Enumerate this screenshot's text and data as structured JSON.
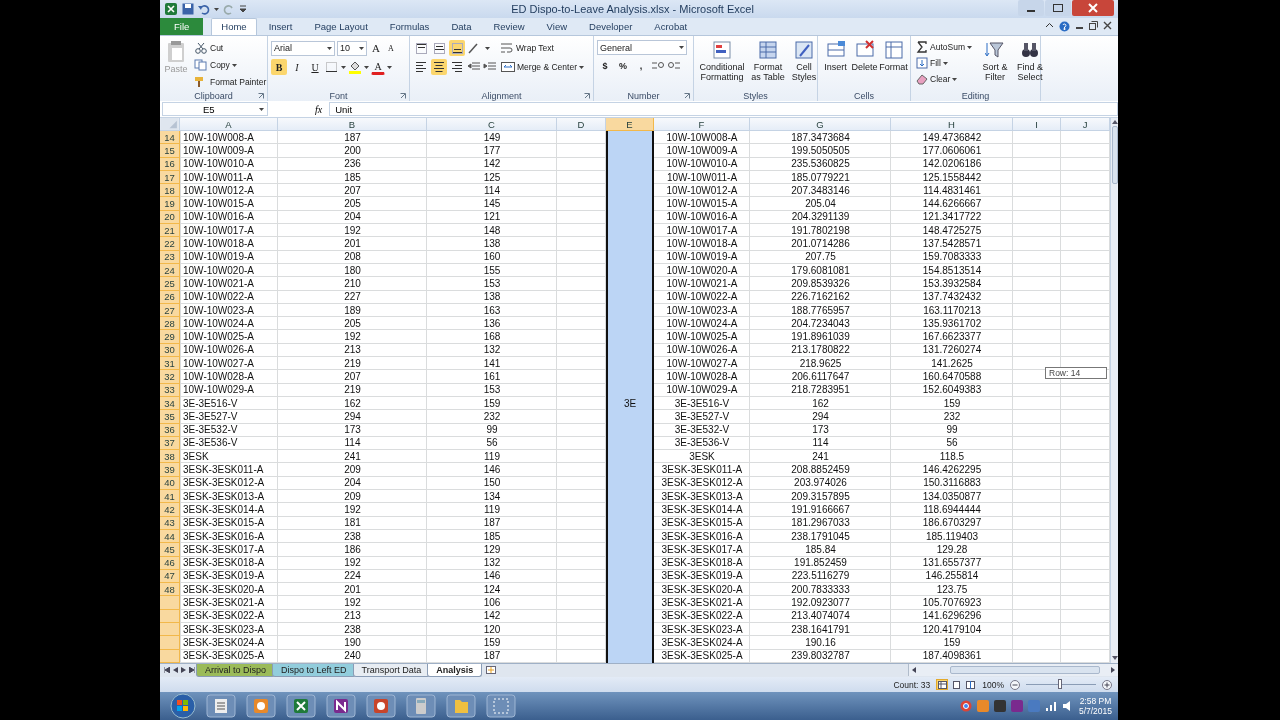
{
  "window": {
    "title": "ED Dispo-to-Leave Analysis.xlsx - Microsoft Excel"
  },
  "ribbon": {
    "tabs": [
      {
        "label": "File",
        "kind": "file",
        "selected": false
      },
      {
        "label": "Home",
        "kind": "tab",
        "selected": true
      },
      {
        "label": "Insert",
        "kind": "tab",
        "selected": false
      },
      {
        "label": "Page Layout",
        "kind": "tab",
        "selected": false
      },
      {
        "label": "Formulas",
        "kind": "tab",
        "selected": false
      },
      {
        "label": "Data",
        "kind": "tab",
        "selected": false
      },
      {
        "label": "Review",
        "kind": "tab",
        "selected": false
      },
      {
        "label": "View",
        "kind": "tab",
        "selected": false
      },
      {
        "label": "Developer",
        "kind": "tab",
        "selected": false
      },
      {
        "label": "Acrobat",
        "kind": "tab",
        "selected": false
      }
    ],
    "clipboard": {
      "label": "Clipboard",
      "paste": {
        "label": "Paste",
        "disabled": true
      },
      "cut": "Cut",
      "copy": "Copy",
      "format_painter": "Format Painter"
    },
    "font": {
      "label": "Font",
      "name": "Arial",
      "size": "10",
      "grow": "A",
      "shrink": "A",
      "font_color": "A",
      "styles": [
        {
          "text": "B",
          "kind": "bold",
          "on": true
        },
        {
          "text": "I",
          "kind": "italic",
          "on": false
        },
        {
          "text": "U",
          "kind": "underline",
          "on": false
        }
      ]
    },
    "alignment": {
      "label": "Alignment",
      "wrap_text": "Wrap Text",
      "merge": "Merge & Center",
      "vertical": [
        {
          "selected": false
        },
        {
          "selected": false
        },
        {
          "selected": true
        }
      ],
      "horizontal": [
        {
          "selected": false
        },
        {
          "selected": true
        },
        {
          "selected": false
        }
      ]
    },
    "number": {
      "label": "Number",
      "format": "General",
      "symbols": [
        "$",
        "%",
        ","
      ]
    },
    "styles": {
      "label": "Styles",
      "buttons": [
        "Conditional Formatting",
        "Format as Table",
        "Cell Styles"
      ]
    },
    "cells": {
      "label": "Cells",
      "buttons": [
        "Insert",
        "Delete",
        "Format"
      ]
    },
    "editing": {
      "label": "Editing",
      "autosum": "AutoSum",
      "fill": "Fill",
      "clear": "Clear",
      "buttons": [
        "Sort & Filter",
        "Find & Select"
      ]
    }
  },
  "formula_bar": {
    "name_box": "E5",
    "function_button": "fx",
    "formula": "Unit"
  },
  "sheet": {
    "columns": [
      {
        "label": "A",
        "selected": false
      },
      {
        "label": "B",
        "selected": false
      },
      {
        "label": "C",
        "selected": false
      },
      {
        "label": "D",
        "selected": false
      },
      {
        "label": "E",
        "selected": true
      },
      {
        "label": "F",
        "selected": false
      },
      {
        "label": "G",
        "selected": false
      },
      {
        "label": "H",
        "selected": false
      },
      {
        "label": "I",
        "selected": false
      },
      {
        "label": "J",
        "selected": false
      }
    ],
    "rows": [
      {
        "number": "14",
        "selected": true,
        "cells": {
          "A": "10W-10W008-A",
          "B": "187",
          "C": "149",
          "F": "10W-10W008-A",
          "G": "187.3473684",
          "H": "149.4736842"
        }
      },
      {
        "number": "15",
        "selected": true,
        "cells": {
          "A": "10W-10W009-A",
          "B": "200",
          "C": "177",
          "F": "10W-10W009-A",
          "G": "199.5050505",
          "H": "177.0606061"
        }
      },
      {
        "number": "16",
        "selected": true,
        "cells": {
          "A": "10W-10W010-A",
          "B": "236",
          "C": "142",
          "F": "10W-10W010-A",
          "G": "235.5360825",
          "H": "142.0206186"
        }
      },
      {
        "number": "17",
        "selected": true,
        "cells": {
          "A": "10W-10W011-A",
          "B": "185",
          "C": "125",
          "F": "10W-10W011-A",
          "G": "185.0779221",
          "H": "125.1558442"
        }
      },
      {
        "number": "18",
        "selected": true,
        "cells": {
          "A": "10W-10W012-A",
          "B": "207",
          "C": "114",
          "F": "10W-10W012-A",
          "G": "207.3483146",
          "H": "114.4831461"
        }
      },
      {
        "number": "19",
        "selected": true,
        "cells": {
          "A": "10W-10W015-A",
          "B": "205",
          "C": "145",
          "F": "10W-10W015-A",
          "G": "205.04",
          "H": "144.6266667"
        }
      },
      {
        "number": "20",
        "selected": true,
        "cells": {
          "A": "10W-10W016-A",
          "B": "204",
          "C": "121",
          "F": "10W-10W016-A",
          "G": "204.3291139",
          "H": "121.3417722"
        }
      },
      {
        "number": "21",
        "selected": true,
        "cells": {
          "A": "10W-10W017-A",
          "B": "192",
          "C": "148",
          "F": "10W-10W017-A",
          "G": "191.7802198",
          "H": "148.4725275"
        }
      },
      {
        "number": "22",
        "selected": true,
        "cells": {
          "A": "10W-10W018-A",
          "B": "201",
          "C": "138",
          "F": "10W-10W018-A",
          "G": "201.0714286",
          "H": "137.5428571"
        }
      },
      {
        "number": "23",
        "selected": true,
        "cells": {
          "A": "10W-10W019-A",
          "B": "208",
          "C": "160",
          "F": "10W-10W019-A",
          "G": "207.75",
          "H": "159.7083333"
        }
      },
      {
        "number": "24",
        "selected": true,
        "cells": {
          "A": "10W-10W020-A",
          "B": "180",
          "C": "155",
          "F": "10W-10W020-A",
          "G": "179.6081081",
          "H": "154.8513514"
        }
      },
      {
        "number": "25",
        "selected": true,
        "cells": {
          "A": "10W-10W021-A",
          "B": "210",
          "C": "153",
          "F": "10W-10W021-A",
          "G": "209.8539326",
          "H": "153.3932584"
        }
      },
      {
        "number": "26",
        "selected": true,
        "cells": {
          "A": "10W-10W022-A",
          "B": "227",
          "C": "138",
          "F": "10W-10W022-A",
          "G": "226.7162162",
          "H": "137.7432432"
        }
      },
      {
        "number": "27",
        "selected": true,
        "cells": {
          "A": "10W-10W023-A",
          "B": "189",
          "C": "163",
          "F": "10W-10W023-A",
          "G": "188.7765957",
          "H": "163.1170213"
        }
      },
      {
        "number": "28",
        "selected": true,
        "cells": {
          "A": "10W-10W024-A",
          "B": "205",
          "C": "136",
          "F": "10W-10W024-A",
          "G": "204.7234043",
          "H": "135.9361702"
        }
      },
      {
        "number": "29",
        "selected": true,
        "cells": {
          "A": "10W-10W025-A",
          "B": "192",
          "C": "168",
          "F": "10W-10W025-A",
          "G": "191.8961039",
          "H": "167.6623377"
        }
      },
      {
        "number": "30",
        "selected": true,
        "cells": {
          "A": "10W-10W026-A",
          "B": "213",
          "C": "132",
          "F": "10W-10W026-A",
          "G": "213.1780822",
          "H": "131.7260274"
        }
      },
      {
        "number": "31",
        "selected": true,
        "cells": {
          "A": "10W-10W027-A",
          "B": "219",
          "C": "141",
          "F": "10W-10W027-A",
          "G": "218.9625",
          "H": "141.2625"
        }
      },
      {
        "number": "32",
        "selected": true,
        "cells": {
          "A": "10W-10W028-A",
          "B": "207",
          "C": "161",
          "F": "10W-10W028-A",
          "G": "206.6117647",
          "H": "160.6470588"
        }
      },
      {
        "number": "33",
        "selected": true,
        "cells": {
          "A": "10W-10W029-A",
          "B": "219",
          "C": "153",
          "F": "10W-10W029-A",
          "G": "218.7283951",
          "H": "152.6049383"
        }
      },
      {
        "number": "34",
        "selected": true,
        "cells": {
          "A": "3E-3E516-V",
          "B": "162",
          "C": "159",
          "E": "3E",
          "F": "3E-3E516-V",
          "G": "162",
          "H": "159"
        }
      },
      {
        "number": "35",
        "selected": true,
        "cells": {
          "A": "3E-3E527-V",
          "B": "294",
          "C": "232",
          "F": "3E-3E527-V",
          "G": "294",
          "H": "232"
        }
      },
      {
        "number": "36",
        "selected": true,
        "cells": {
          "A": "3E-3E532-V",
          "B": "173",
          "C": "99",
          "F": "3E-3E532-V",
          "G": "173",
          "H": "99"
        }
      },
      {
        "number": "37",
        "selected": true,
        "cells": {
          "A": "3E-3E536-V",
          "B": "114",
          "C": "56",
          "F": "3E-3E536-V",
          "G": "114",
          "H": "56"
        }
      },
      {
        "number": "38",
        "selected": true,
        "cells": {
          "A": "3ESK",
          "B": "241",
          "C": "119",
          "F": "3ESK",
          "G": "241",
          "H": "118.5"
        }
      },
      {
        "number": "39",
        "selected": true,
        "cells": {
          "A": "3ESK-3ESK011-A",
          "B": "209",
          "C": "146",
          "F": "3ESK-3ESK011-A",
          "G": "208.8852459",
          "H": "146.4262295"
        }
      },
      {
        "number": "40",
        "selected": true,
        "cells": {
          "A": "3ESK-3ESK012-A",
          "B": "204",
          "C": "150",
          "F": "3ESK-3ESK012-A",
          "G": "203.974026",
          "H": "150.3116883"
        }
      },
      {
        "number": "41",
        "selected": true,
        "cells": {
          "A": "3ESK-3ESK013-A",
          "B": "209",
          "C": "134",
          "F": "3ESK-3ESK013-A",
          "G": "209.3157895",
          "H": "134.0350877"
        }
      },
      {
        "number": "42",
        "selected": true,
        "cells": {
          "A": "3ESK-3ESK014-A",
          "B": "192",
          "C": "119",
          "F": "3ESK-3ESK014-A",
          "G": "191.9166667",
          "H": "118.6944444"
        }
      },
      {
        "number": "43",
        "selected": true,
        "cells": {
          "A": "3ESK-3ESK015-A",
          "B": "181",
          "C": "187",
          "F": "3ESK-3ESK015-A",
          "G": "181.2967033",
          "H": "186.6703297"
        }
      },
      {
        "number": "44",
        "selected": true,
        "cells": {
          "A": "3ESK-3ESK016-A",
          "B": "238",
          "C": "185",
          "F": "3ESK-3ESK016-A",
          "G": "238.1791045",
          "H": "185.119403"
        }
      },
      {
        "number": "45",
        "selected": true,
        "cells": {
          "A": "3ESK-3ESK017-A",
          "B": "186",
          "C": "129",
          "F": "3ESK-3ESK017-A",
          "G": "185.84",
          "H": "129.28"
        }
      },
      {
        "number": "46",
        "selected": true,
        "cells": {
          "A": "3ESK-3ESK018-A",
          "B": "192",
          "C": "132",
          "F": "3ESK-3ESK018-A",
          "G": "191.852459",
          "H": "131.6557377"
        }
      },
      {
        "number": "47",
        "selected": true,
        "cells": {
          "A": "3ESK-3ESK019-A",
          "B": "224",
          "C": "146",
          "F": "3ESK-3ESK019-A",
          "G": "223.5116279",
          "H": "146.255814"
        }
      },
      {
        "number": "48",
        "selected": true,
        "cells": {
          "A": "3ESK-3ESK020-A",
          "B": "201",
          "C": "124",
          "F": "3ESK-3ESK020-A",
          "G": "200.7833333",
          "H": "123.75"
        }
      },
      {
        "selected": true,
        "cells": {
          "A": "3ESK-3ESK021-A",
          "B": "192",
          "C": "106",
          "F": "3ESK-3ESK021-A",
          "G": "192.0923077",
          "H": "105.7076923"
        }
      },
      {
        "selected": true,
        "cells": {
          "A": "3ESK-3ESK022-A",
          "B": "213",
          "C": "142",
          "F": "3ESK-3ESK022-A",
          "G": "213.4074074",
          "H": "141.6296296"
        }
      },
      {
        "selected": true,
        "cells": {
          "A": "3ESK-3ESK023-A",
          "B": "238",
          "C": "120",
          "F": "3ESK-3ESK023-A",
          "G": "238.1641791",
          "H": "120.4179104"
        }
      },
      {
        "selected": true,
        "cells": {
          "A": "3ESK-3ESK024-A",
          "B": "190",
          "C": "159",
          "F": "3ESK-3ESK024-A",
          "G": "190.16",
          "H": "159"
        }
      },
      {
        "selected": true,
        "cells": {
          "A": "3ESK-3ESK025-A",
          "B": "240",
          "C": "187",
          "F": "3ESK-3ESK025-A",
          "G": "239.8032787",
          "H": "187.4098361"
        }
      }
    ],
    "tooltip": "Row: 14"
  },
  "sheet_tabs": [
    {
      "label": "Arrival to Dispo",
      "selected": false,
      "color": "#9bbb59"
    },
    {
      "label": "Dispo to Left ED",
      "selected": false,
      "color": "#92cddc"
    },
    {
      "label": "Transport Data",
      "selected": false
    },
    {
      "label": "Analysis",
      "selected": true
    }
  ],
  "status_bar": {
    "count": "Count: 33",
    "views": [
      {
        "selected": true
      },
      {
        "selected": false
      },
      {
        "selected": false
      }
    ],
    "zoom": "100%",
    "zoom_slider": {
      "level": 0.5
    }
  },
  "taskbar": {
    "time": "2:58 PM",
    "date": "5/7/2015"
  }
}
